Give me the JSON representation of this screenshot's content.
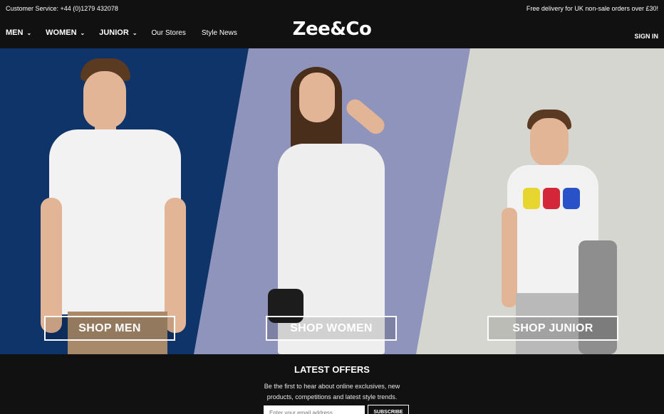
{
  "topbar": {
    "customer_service": "Customer Service:   +44 (0)1279 432078",
    "delivery": "Free delivery for UK non-sale orders over £30!"
  },
  "header": {
    "logo": "Zee&Co",
    "nav": [
      {
        "label": "MEN",
        "has_dropdown": true
      },
      {
        "label": "WOMEN",
        "has_dropdown": true
      },
      {
        "label": "JUNIOR",
        "has_dropdown": true
      },
      {
        "label": "Our Stores",
        "has_dropdown": false
      },
      {
        "label": "Style News",
        "has_dropdown": false
      }
    ],
    "sign_in": "SIGN IN"
  },
  "hero": {
    "panels": [
      {
        "cta": "SHOP MEN",
        "bg_color": "#0e3469"
      },
      {
        "cta": "SHOP WOMEN",
        "bg_color": "#8f94bc"
      },
      {
        "cta": "SHOP JUNIOR",
        "bg_color": "#d5d6cf"
      }
    ]
  },
  "offers": {
    "title": "LATEST OFFERS",
    "text": "Be the first to hear about online exclusives, new products, competitions and latest style trends.",
    "email_placeholder": "Enter your email address",
    "subscribe_label": "SUBSCRIBE"
  }
}
